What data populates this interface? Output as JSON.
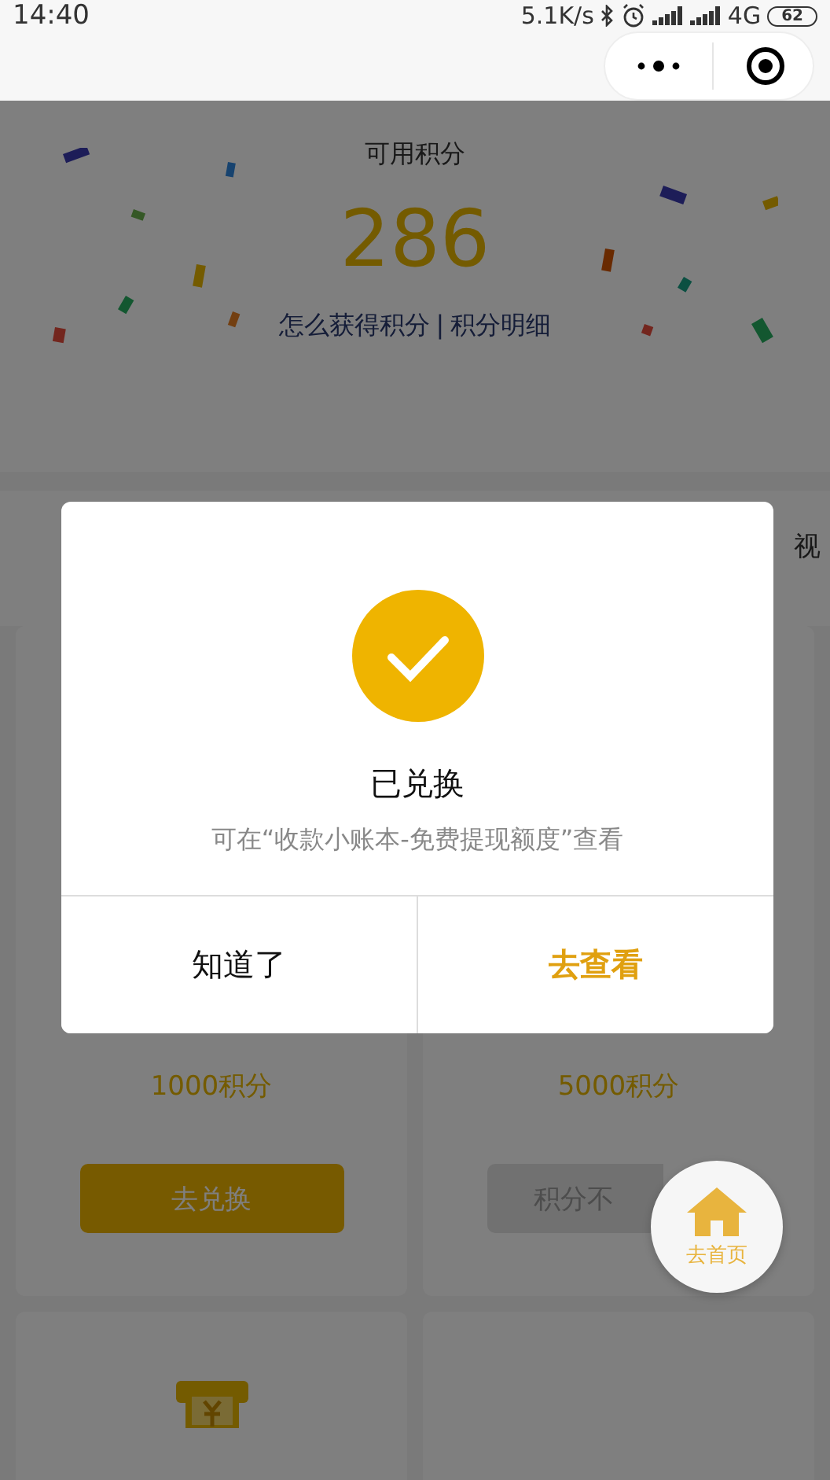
{
  "status_bar": {
    "time": "14:40",
    "speed": "5.1K/s",
    "network": "4G",
    "battery": "62"
  },
  "header": {
    "title": "可用积分",
    "points": "286",
    "links": [
      "怎么获得积分",
      "积分明细"
    ],
    "separator": "|"
  },
  "section": {
    "label": "视"
  },
  "cards": [
    {
      "points": "1000积分",
      "button": "去兑换",
      "disabled": false
    },
    {
      "points": "5000积分",
      "button": "积分不",
      "disabled": true
    }
  ],
  "dialog": {
    "title": "已兑换",
    "message": "可在“收款小账本-免费提现额度”查看",
    "buttons": [
      {
        "label": "知道了",
        "kind": "secondary"
      },
      {
        "label": "去查看",
        "kind": "primary"
      }
    ]
  },
  "fab": {
    "label": "去首页"
  }
}
